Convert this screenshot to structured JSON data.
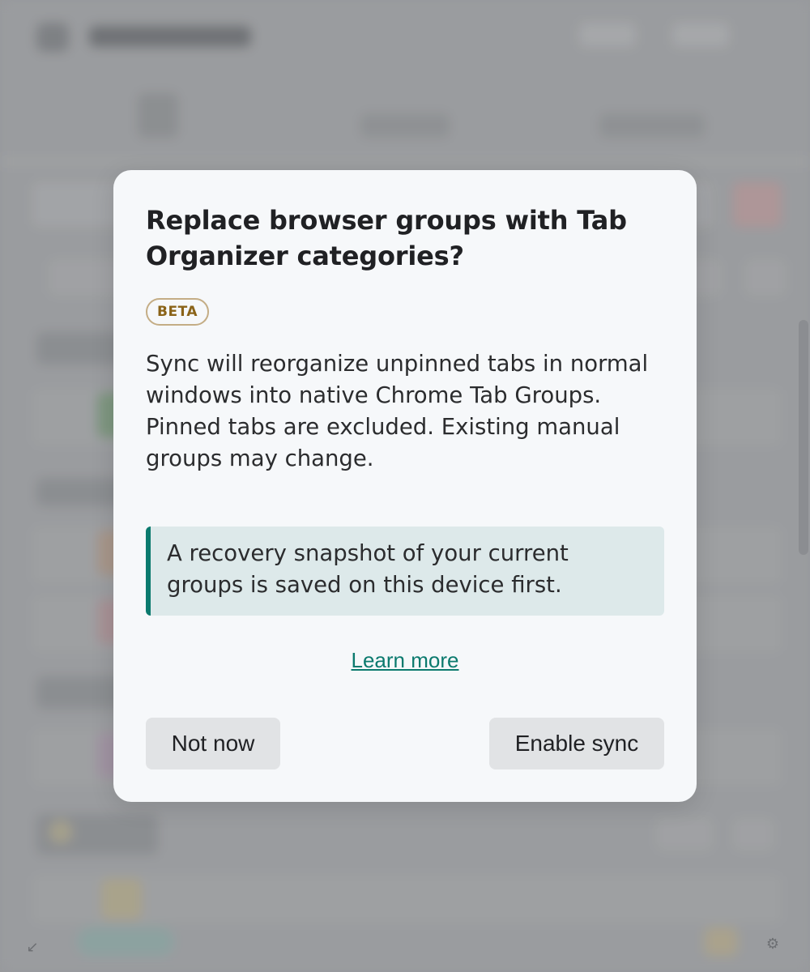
{
  "dialog": {
    "title": "Replace browser groups with Tab Organizer categories?",
    "badge": "BETA",
    "body": "Sync will reorganize unpinned tabs in normal windows into native Chrome Tab Groups. Pinned tabs are excluded. Existing manual groups may change.",
    "note": "A recovery snapshot of your current groups is saved on this device first.",
    "learn_more": "Learn more",
    "secondary_button": "Not now",
    "primary_button": "Enable sync"
  },
  "colors": {
    "accent": "#0b7a6e",
    "badge_text": "#8a6318",
    "badge_border": "#c4ad85",
    "note_bg": "#dde9ea",
    "dialog_bg": "#f6f8fa"
  },
  "background": {
    "corner_icons": [
      "collapse-icon",
      "lock-icon",
      "settings-icon"
    ]
  }
}
